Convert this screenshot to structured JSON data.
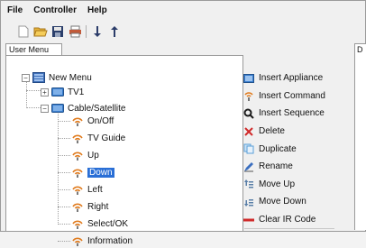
{
  "menubar": {
    "items": [
      "File",
      "Controller",
      "Help"
    ]
  },
  "toolbar": {
    "buttons": [
      "new-icon",
      "open-icon",
      "save-icon",
      "print-icon",
      "arrow-down-icon",
      "arrow-up-icon"
    ]
  },
  "tabs": {
    "left": "User Menu",
    "right": "D"
  },
  "tree": {
    "root": "New Menu",
    "tv": "TV1",
    "cable": "Cable/Satellite",
    "commands": [
      "On/Off",
      "TV Guide",
      "Up",
      "Down",
      "Left",
      "Right",
      "Select/OK",
      "Information"
    ],
    "selected": "Down"
  },
  "commands": [
    {
      "label": "Insert Appliance",
      "icon": "appliance-icon",
      "color": "#3b7fd0"
    },
    {
      "label": "Insert Command",
      "icon": "remote-signal-icon",
      "color": "#e07a1c"
    },
    {
      "label": "Insert Sequence",
      "icon": "sequence-icon",
      "color": "#1b1b1b"
    },
    {
      "label": "Delete",
      "icon": "delete-icon",
      "color": "#d02a2a"
    },
    {
      "label": "Duplicate",
      "icon": "duplicate-icon",
      "color": "#5aa0d8"
    },
    {
      "label": "Rename",
      "icon": "rename-icon",
      "color": "#3b6fc0"
    },
    {
      "label": "Move Up",
      "icon": "move-up-icon",
      "color": "#5a7fa8"
    },
    {
      "label": "Move Down",
      "icon": "move-down-icon",
      "color": "#5a7fa8"
    },
    {
      "label": "Clear IR Code",
      "icon": "clear-icon",
      "color": "#d02a2a"
    }
  ],
  "colors": {
    "selection": "#2a6fd6"
  }
}
